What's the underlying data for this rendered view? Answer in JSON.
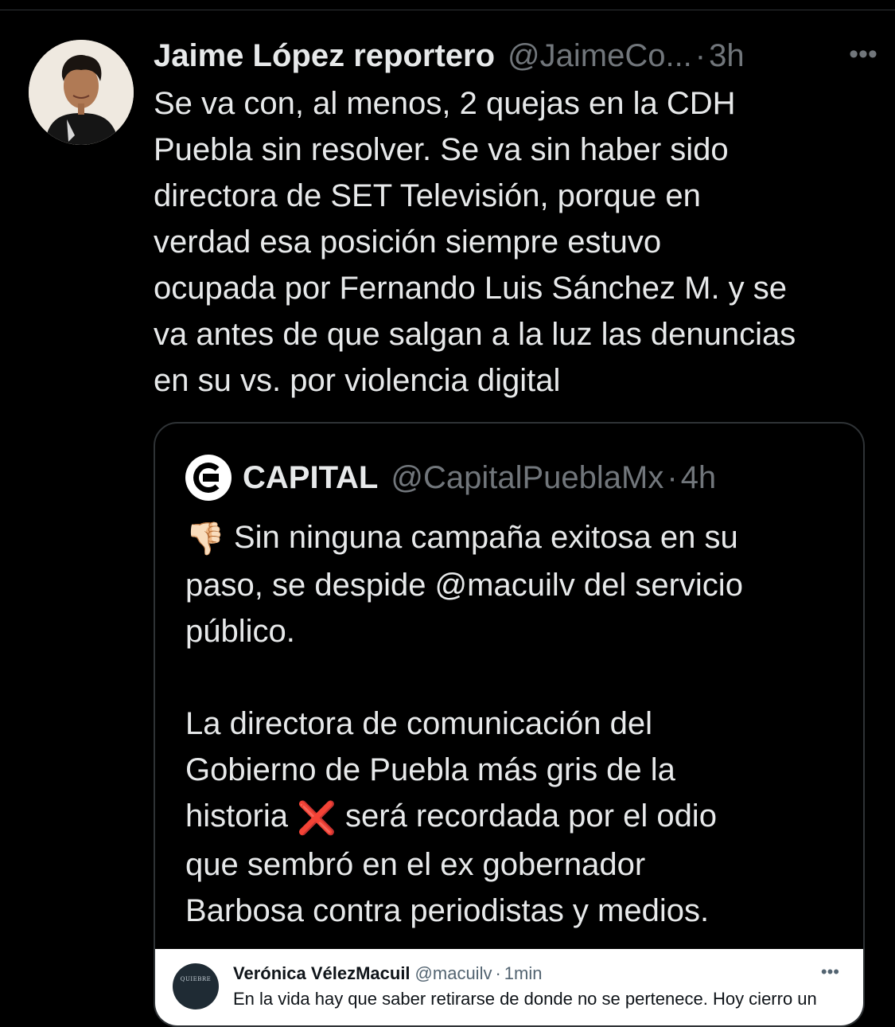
{
  "tweet": {
    "author_name": "Jaime López reportero",
    "author_handle": "@JaimeCo...",
    "separator": "·",
    "time": "3h",
    "more": "•••",
    "text": "Se va con, al menos, 2 quejas en la CDH\nPuebla sin resolver. Se va sin haber sido\ndirectora de SET Televisión, porque en\nverdad esa posición siempre estuvo\nocupada por Fernando Luis Sánchez M. y se\nva antes de que salgan a la luz las denuncias\nen su vs. por violencia digital"
  },
  "quote": {
    "author_name": "CAPITAL",
    "author_handle": "@CapitalPueblaMx",
    "separator": "·",
    "time": "4h",
    "emoji_thumbs_down": "👎🏻",
    "text_line1": " Sin ninguna campaña exitosa en su\npaso, se despide @macuilv del servicio\npúblico.\n\nLa directora de comunicación del\nGobierno de Puebla más gris de la\nhistoria ",
    "emoji_cross": "❌",
    "text_line2": " será recordada por el odio\nque sembró en el ex gobernador\nBarbosa contra periodistas y medios."
  },
  "embed": {
    "author_name": "Verónica VélezMacuil",
    "author_handle": "@macuilv",
    "separator": "·",
    "time": "1min",
    "more": "•••",
    "avatar_text": "QUIEBRE",
    "text": "En la vida hay que saber retirarse de donde no se pertenece. Hoy cierro un"
  },
  "colors": {
    "background": "#000000",
    "text_primary": "#e7e9ea",
    "text_secondary": "#71767b",
    "border": "#2f3336",
    "cross_red": "#e0212e"
  },
  "icons": {
    "more": "more-horizontal-icon",
    "quote_avatar": "capital-logo-icon"
  }
}
